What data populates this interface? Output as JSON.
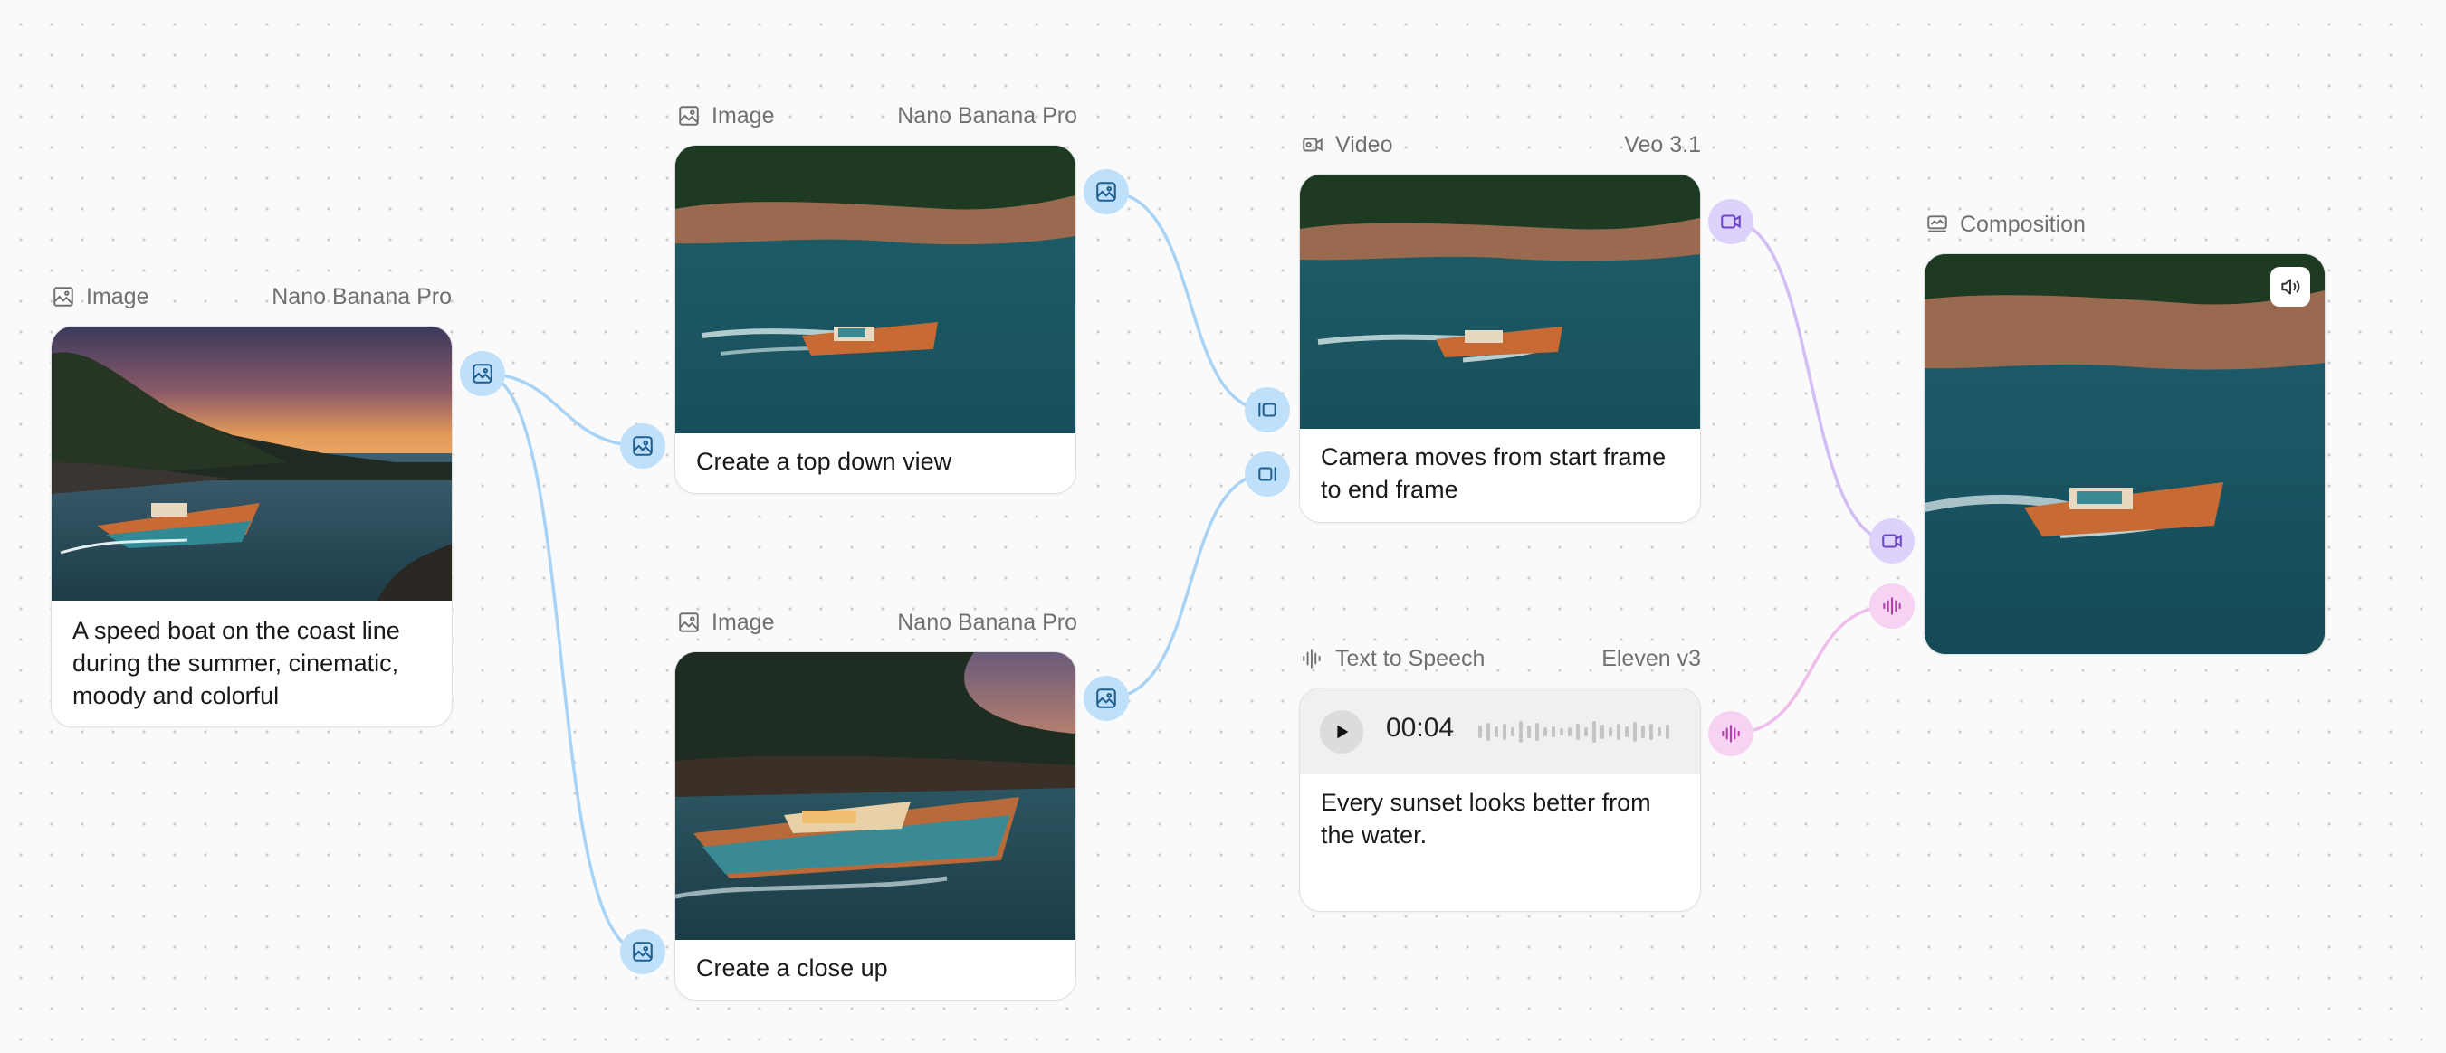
{
  "nodes": {
    "image1": {
      "type_label": "Image",
      "model": "Nano Banana Pro",
      "prompt": "A speed boat on the coast line during the summer, cinematic, moody and colorful"
    },
    "image2": {
      "type_label": "Image",
      "model": "Nano Banana Pro",
      "prompt": "Create a top down view"
    },
    "image3": {
      "type_label": "Image",
      "model": "Nano Banana Pro",
      "prompt": "Create a close up"
    },
    "video": {
      "type_label": "Video",
      "model": "Veo 3.1",
      "prompt": "Camera moves from start frame to end frame"
    },
    "tts": {
      "type_label": "Text to Speech",
      "model": "Eleven v3",
      "time": "00:04",
      "prompt": "Every sunset looks better from the water."
    },
    "composition": {
      "type_label": "Composition"
    }
  },
  "icons": [
    "image-icon",
    "video-icon",
    "waveform-icon",
    "composition-icon",
    "play-icon",
    "volume-icon",
    "start-frame-icon",
    "end-frame-icon"
  ],
  "colors": {
    "image_port": "#bfe0fb",
    "image_wire": "#a9d3f5",
    "video_port": "#ddd2fb",
    "video_wire": "#d2bdf5",
    "audio_port": "#f6d2f3",
    "audio_wire": "#efbdeb",
    "canvas": "#fafafa"
  }
}
